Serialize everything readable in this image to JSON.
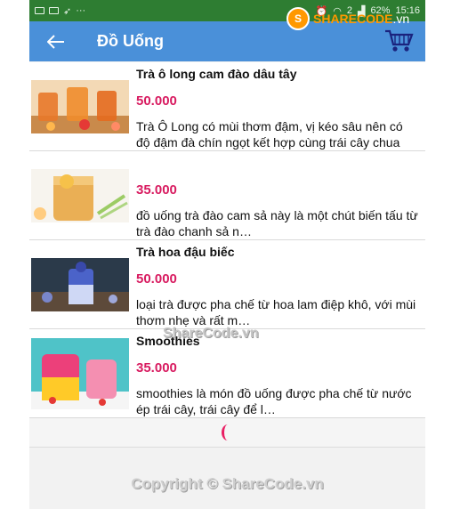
{
  "status_bar": {
    "battery": "62%",
    "time": "15:16",
    "signal_badge": "2"
  },
  "app_bar": {
    "title": "Đồ Uống"
  },
  "watermark": {
    "brand_main": "SHARECODE",
    "brand_suffix": ".vn",
    "middle": "ShareCode.vn",
    "copyright": "Copyright © ShareCode.vn"
  },
  "products": [
    {
      "name": "Trà ô long cam đào dâu tây",
      "price": "50.000",
      "description": "Trà Ô Long có mùi thơm đậm, vị kéo sâu nên có độ đậm đà chín ngọt kết hợp cùng trái cây chua"
    },
    {
      "name": "",
      "price": "35.000",
      "description": "đồ uống trà đào cam sả này là một chút biến tấu từ trà đào chanh sả n…"
    },
    {
      "name": "Trà hoa đậu biếc",
      "price": "50.000",
      "description": " loại trà được pha chế từ hoa lam điệp khô, với mùi thơm nhẹ và rất m…"
    },
    {
      "name": "Smoothies",
      "price": "35.000",
      "description": "smoothies là món đồ uống được pha chế từ nước ép trái cây, trái cây để l…"
    }
  ],
  "colors": {
    "appbar": "#4a90d9",
    "statusbar": "#2e7d32",
    "price": "#d81b60",
    "spinner": "#e91e63"
  }
}
